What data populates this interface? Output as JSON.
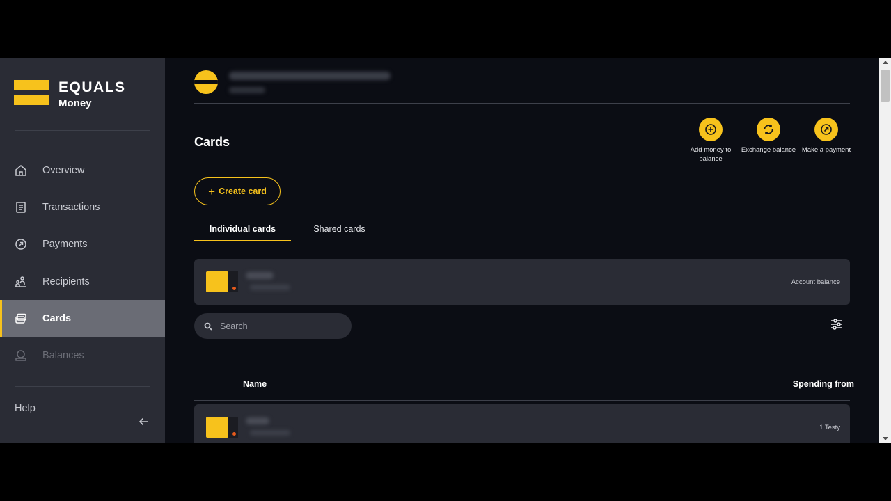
{
  "brand": {
    "name": "EQUALS",
    "sub": "Money"
  },
  "sidebar": {
    "items": [
      {
        "label": "Overview",
        "icon": "home-icon",
        "active": false,
        "disabled": false
      },
      {
        "label": "Transactions",
        "icon": "receipt-icon",
        "active": false,
        "disabled": false
      },
      {
        "label": "Payments",
        "icon": "arrow-circle-icon",
        "active": false,
        "disabled": false
      },
      {
        "label": "Recipients",
        "icon": "recipients-icon",
        "active": false,
        "disabled": false
      },
      {
        "label": "Cards",
        "icon": "cards-icon",
        "active": true,
        "disabled": false
      },
      {
        "label": "Balances",
        "icon": "balance-icon",
        "active": false,
        "disabled": true
      }
    ],
    "help": "Help"
  },
  "page": {
    "title": "Cards"
  },
  "quick_actions": [
    {
      "label": "Add money to balance",
      "icon": "plus-circle-icon"
    },
    {
      "label": "Exchange balance",
      "icon": "exchange-icon"
    },
    {
      "label": "Make a payment",
      "icon": "send-icon"
    }
  ],
  "create_button": "Create card",
  "tabs": [
    {
      "label": "Individual cards",
      "active": true
    },
    {
      "label": "Shared cards",
      "active": false
    }
  ],
  "account_card": {
    "balance_label": "Account balance"
  },
  "search": {
    "placeholder": "Search"
  },
  "table": {
    "headers": {
      "name": "Name",
      "spending_from": "Spending from"
    },
    "rows": [
      {
        "spending_from": "1 Testy"
      }
    ]
  },
  "colors": {
    "accent": "#f7c21c",
    "sidebar_bg": "#2a2c35",
    "main_bg": "#0b0d14",
    "active_nav": "#6a6c75"
  }
}
